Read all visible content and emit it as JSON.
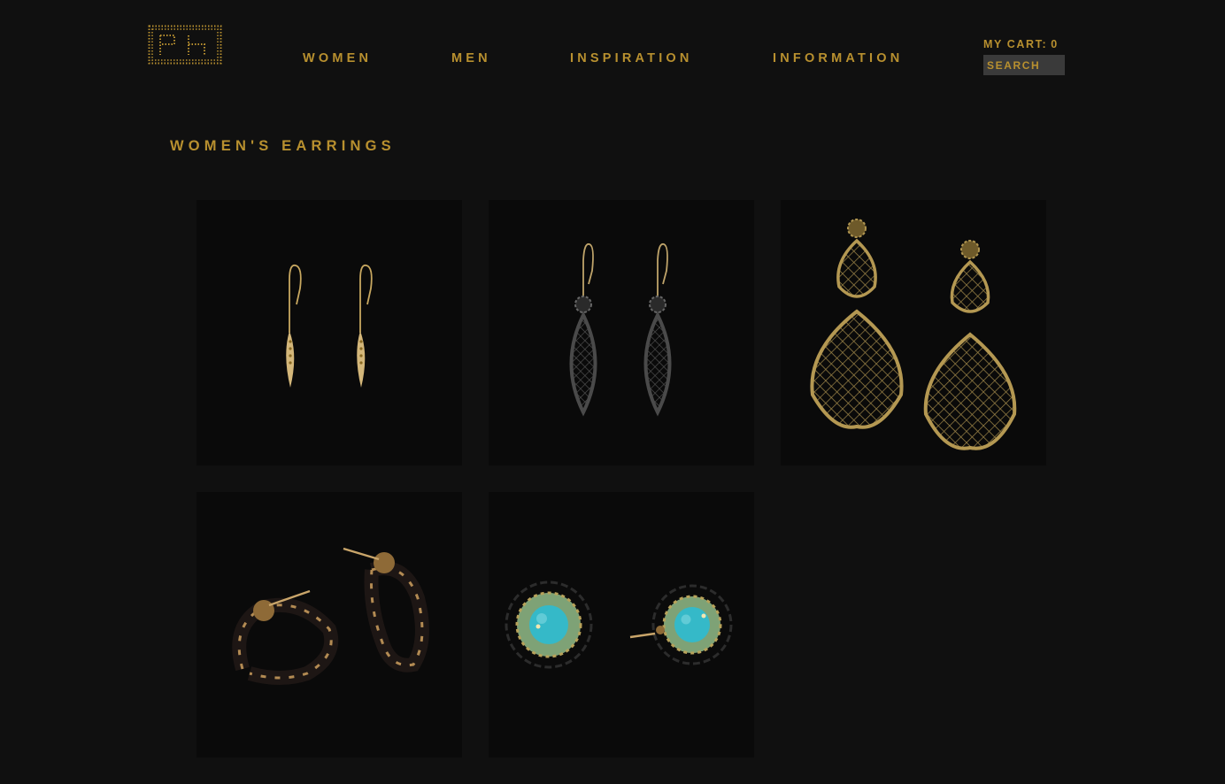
{
  "nav": {
    "items": [
      {
        "label": "WOMEN"
      },
      {
        "label": "MEN"
      },
      {
        "label": "INSPIRATION"
      },
      {
        "label": "INFORMATION"
      }
    ]
  },
  "cart": {
    "label": "MY CART:",
    "count": "0"
  },
  "search": {
    "placeholder": "SEARCH"
  },
  "page": {
    "title": "WOMEN'S EARRINGS"
  },
  "products": [
    {
      "image": "gold-leaf-drop-earrings"
    },
    {
      "image": "oxidized-lattice-drop-earrings"
    },
    {
      "image": "gold-lattice-chandelier-earrings"
    },
    {
      "image": "twisted-black-gold-hoop-earrings"
    },
    {
      "image": "turquoise-flower-stud-earrings"
    }
  ],
  "colors": {
    "background": "#101010",
    "accent": "#b8902f",
    "search_bg": "#3a3a3a"
  }
}
